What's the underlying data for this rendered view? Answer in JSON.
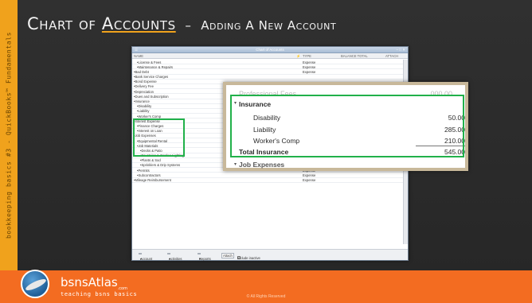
{
  "slide": {
    "title_main_prefix": "Chart of ",
    "title_main_underlined": "Accounts",
    "title_dash": "–",
    "title_sub": "Adding A New Account",
    "vertical_text": "bookkeeping basics #3 - QuickBooks™ Fundamentals"
  },
  "qb_window": {
    "title": "Chart of Accounts",
    "window_controls": "– □ ✕",
    "icon": "☰",
    "columns": {
      "name": "NAME",
      "bolt": "⚡",
      "type": "TYPE",
      "balance": "BALANCE TOTAL",
      "attach": "ATTACH"
    },
    "rows": [
      {
        "name": "•License & Fees",
        "type": "Expense",
        "indent": 1
      },
      {
        "name": "•Maintenance & Repairs",
        "type": "Expense",
        "indent": 1
      },
      {
        "name": "•Bad Debt",
        "type": "Expense",
        "indent": 0
      },
      {
        "name": "•Bank Service Charges",
        "type": "",
        "indent": 0
      },
      {
        "name": "•Bond Expense",
        "type": "",
        "indent": 0
      },
      {
        "name": "•Delivery Fee",
        "type": "",
        "indent": 0
      },
      {
        "name": "•Depreciation",
        "type": "",
        "indent": 0
      },
      {
        "name": "•Dues and Subscription",
        "type": "",
        "indent": 0
      },
      {
        "name": "•Insurance",
        "type": "",
        "indent": 0
      },
      {
        "name": "•Disability",
        "type": "",
        "indent": 1
      },
      {
        "name": "•Liability",
        "type": "",
        "indent": 1
      },
      {
        "name": "•Worker's Comp",
        "type": "",
        "indent": 1
      },
      {
        "name": "•Interest Expense",
        "type": "",
        "indent": 0
      },
      {
        "name": "•Finance Charges",
        "type": "",
        "indent": 1
      },
      {
        "name": "•Interest on Loan",
        "type": "",
        "indent": 1
      },
      {
        "name": "•Job Expenses",
        "type": "",
        "indent": 0
      },
      {
        "name": "•Equipmental Rental",
        "type": "",
        "indent": 1
      },
      {
        "name": "•Job Materials",
        "type": "Expense",
        "indent": 1
      },
      {
        "name": "•Decks & Patio",
        "type": "Expense",
        "indent": 2
      },
      {
        "name": "•Fountains & Garden Lighting",
        "type": "Expense",
        "indent": 2
      },
      {
        "name": "•Plants & Sod",
        "type": "Expense",
        "indent": 2
      },
      {
        "name": "•Sprinklers & Drip Systems",
        "type": "Expense",
        "indent": 2
      },
      {
        "name": "•Permits",
        "type": "Expense",
        "indent": 1
      },
      {
        "name": "•Subcontractors",
        "type": "Expense",
        "indent": 1
      },
      {
        "name": "•Mileage Reimbursement",
        "type": "Expense",
        "indent": 0
      }
    ],
    "footer": {
      "account": "Account",
      "activities": "Activities",
      "reports": "Reports",
      "attach": "Attach",
      "include_inactive": "Include inactive",
      "dropdown": "▾"
    }
  },
  "zoom_panel": {
    "ghost_left": "Professional Fees",
    "ghost_right": "000.00",
    "section_title": "Insurance",
    "items": [
      {
        "label": "Disability",
        "value": "50.00"
      },
      {
        "label": "Liability",
        "value": "285.00"
      },
      {
        "label": "Worker's Comp",
        "value": "210.00"
      }
    ],
    "total_label": "Total Insurance",
    "total_value": "545.00",
    "next_section": "Job Expenses",
    "expand_glyph": "▾"
  },
  "footer": {
    "brand": "bsnsAtlas",
    "brand_suffix": ".com",
    "tagline": "teaching bsns basics",
    "copyright": "© All Rights Reserved"
  },
  "colors": {
    "accent_orange": "#f0a21c",
    "footer_orange": "#f36c21",
    "highlight_green": "#21b14a",
    "zoom_border": "#c8b89a"
  }
}
